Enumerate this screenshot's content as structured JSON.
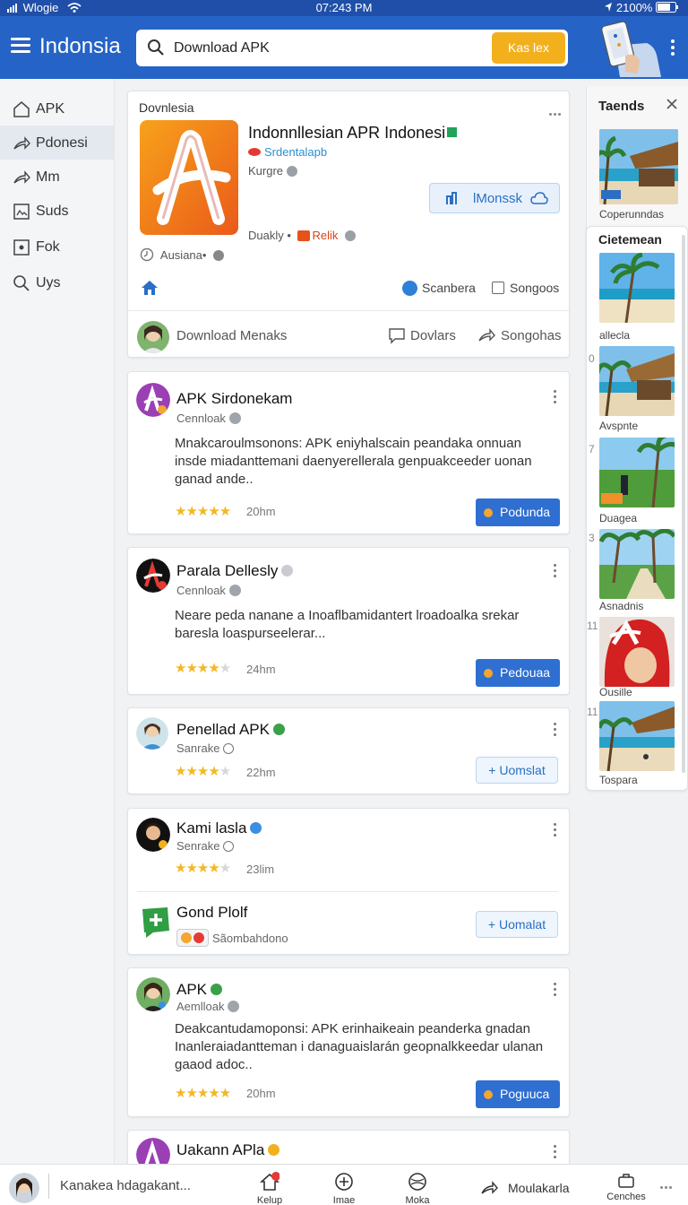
{
  "status": {
    "carrier": "Wlogie",
    "time": "07:243 PM",
    "battery": "2100%"
  },
  "appbar": {
    "title": "Indonsia",
    "search_value": "Download APK",
    "search_button": "Kas lex"
  },
  "nav": [
    {
      "label": "APK"
    },
    {
      "label": "Pdonesi"
    },
    {
      "label": "Mm"
    },
    {
      "label": "Suds"
    },
    {
      "label": "Fok"
    },
    {
      "label": "Uys"
    }
  ],
  "hero": {
    "label": "Dovnlesia",
    "app_name": "Indonnllesian APR Indonesi",
    "developer": "Srdentalapb",
    "category": "Kurgre",
    "action_button": "lMonssk",
    "meta_left": "Duakly •",
    "meta_badge": "Relik",
    "author": "Ausiana•",
    "check1": "Scanbera",
    "check2": "Songoos",
    "footer_text": "Download Menaks",
    "footer_action1": "Dovlars",
    "footer_action2": "Songohas"
  },
  "posts": [
    {
      "title": "APK Sirdonekam",
      "sub": "Cennloak",
      "body": "Mnakcaroulmsonons: APK eniyhalscain peandaka onnuan insde miadanttemani daenyerellerala genpuakceeder uonan ganad ande..",
      "rating": 5,
      "time": "20hm",
      "button": "Podunda"
    },
    {
      "title": "Parala Dellesly",
      "sub": "Cennloak",
      "body": "Neare peda nanane a Inoaflbamidantert lroadoalka srekar baresla loaspurseelerar...",
      "rating": 4,
      "time": "24hm",
      "button": "Pedouaa"
    },
    {
      "title": "Penellad APK",
      "sub": "Sanrake",
      "rating": 4,
      "time": "22hm",
      "button": "Uomslat"
    },
    {
      "title": "Kami lasla",
      "sub": "Senrake",
      "rating": 4,
      "time": "23lim",
      "title2": "Gond Plolf",
      "sub2": "Sãombahdono",
      "button": "Uomalat"
    },
    {
      "title": "APK",
      "sub": "Aemlloak",
      "body": "Deakcantudamoponsi: APK erinhaikeain peanderka gnadan Inanleraiadantteman i danaguaislarán geopnalkkeedar ulanan gaaod adoc..",
      "rating": 5,
      "time": "20hm",
      "button": "Poguuca"
    },
    {
      "title": "Uakann APla"
    }
  ],
  "right_panel": {
    "trends_title": "Taends",
    "trends_caption": "Coperunndas",
    "section_title": "Cietemean",
    "items": [
      {
        "caption": "allecla",
        "num": "0"
      },
      {
        "caption": "Avspnte",
        "num": "7"
      },
      {
        "caption": "Duagea",
        "num": "3"
      },
      {
        "caption": "Asnadnis",
        "num": "11"
      },
      {
        "caption": "Ousille",
        "num": "11"
      },
      {
        "caption": "Tospara",
        "num": ""
      }
    ]
  },
  "bottom": {
    "input_text": "Kanakea hdagakant...",
    "items": [
      "Kelup",
      "Imae",
      "Moka"
    ],
    "text_action": "Moulakarla",
    "last": "Cenches"
  }
}
